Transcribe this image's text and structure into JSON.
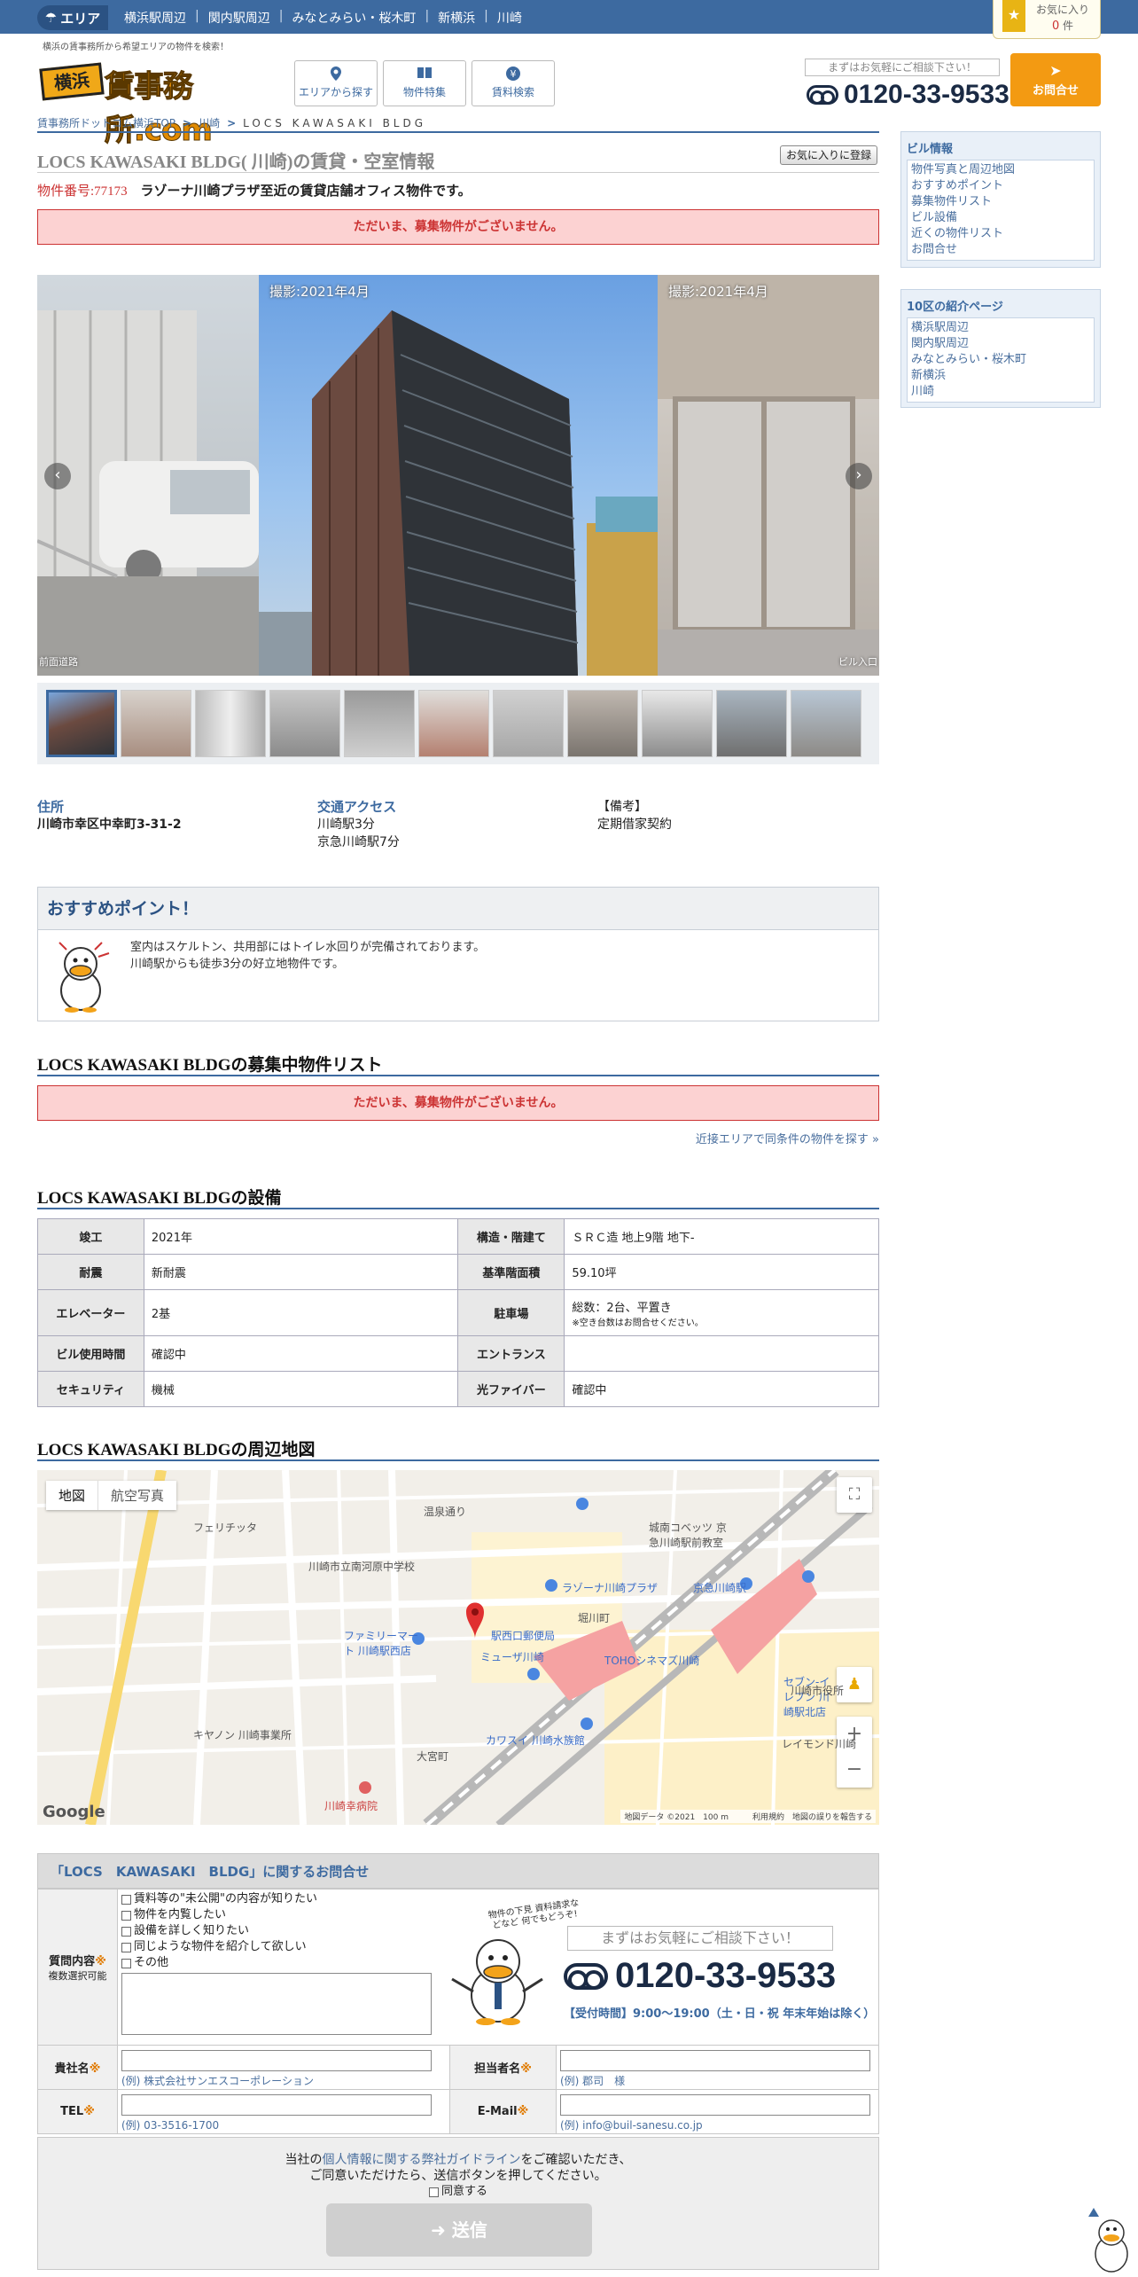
{
  "topbar": {
    "area_label": "エリア",
    "links": [
      "横浜駅周辺",
      "関内駅周辺",
      "みなとみらい・桜木町",
      "新横浜",
      "川崎"
    ],
    "favorites": {
      "label": "お気に入り",
      "count": "0",
      "unit": "件"
    }
  },
  "header": {
    "tagline": "横浜の賃事務所から希望エリアの物件を検索！",
    "logo_badge": "横浜",
    "logo_name": "賃事務所.com",
    "nav": [
      {
        "label": "エリアから探す",
        "icon": "pin-icon"
      },
      {
        "label": "物件特集",
        "icon": "book-icon"
      },
      {
        "label": "賃料検索",
        "icon": "yen-icon"
      }
    ],
    "consult_text": "まずはお気軽にご相談下さい！",
    "phone": "0120-33-9533",
    "contact_label": "お問合せ"
  },
  "breadcrumb": {
    "items": [
      "賃事務所ドットコム横浜TOP",
      "川崎"
    ],
    "current": "LOCS KAWASAKI BLDG"
  },
  "property": {
    "title": "LOCS KAWASAKI BLDG( 川崎)の賃貸・空室情報",
    "fav_add_label": "お気に入りに登録",
    "number_label": "物件番号:77173",
    "description": "ラゾーナ川崎プラザ至近の賃貸店舗オフィス物件です。",
    "no_vacancy": "ただいま、募集物件がございません。"
  },
  "gallery": {
    "center_caption": "撮影:2021年4月",
    "right_caption": "撮影:2021年4月",
    "left_sub": "前面道路",
    "right_sub": "ビル入口",
    "thumb_count": 11
  },
  "info": {
    "address_label": "住所",
    "address": "川崎市幸区中幸町3-31-2",
    "access_label": "交通アクセス",
    "access": [
      "川崎駅3分",
      "京急川崎駅7分"
    ],
    "remarks_label": "【備考】",
    "remarks": "定期借家契約"
  },
  "recommend": {
    "title": "おすすめポイント！",
    "lines": [
      "室内はスケルトン、共用部にはトイレ水回りが完備されております。",
      "川崎駅からも徒歩3分の好立地物件です。"
    ]
  },
  "listing": {
    "title": "LOCS KAWASAKI BLDGの募集中物件リスト",
    "no_vacancy": "ただいま、募集物件がございません。",
    "near_link": "近接エリアで同条件の物件を探す »"
  },
  "facilities": {
    "title": "LOCS KAWASAKI BLDGの設備",
    "rows": [
      {
        "h1": "竣工",
        "v1": "2021年",
        "h2": "構造・階建て",
        "v2": "ＳＲＣ造 地上9階 地下-"
      },
      {
        "h1": "耐震",
        "v1": "新耐震",
        "h2": "基準階面積",
        "v2": "59.10坪"
      },
      {
        "h1": "エレベーター",
        "v1": "2基",
        "h2": "駐車場",
        "v2": "総数：2台、平置き",
        "note": "※空き台数はお問合せください。"
      },
      {
        "h1": "ビル使用時間",
        "v1": "確認中",
        "h2": "エントランス",
        "v2": ""
      },
      {
        "h1": "セキュリティ",
        "v1": "機械",
        "h2": "光ファイバー",
        "v2": "確認中"
      }
    ]
  },
  "map": {
    "title": "LOCS KAWASAKI BLDGの周辺地図",
    "tab_map": "地図",
    "tab_satellite": "航空写真",
    "labels": [
      {
        "t": "フェリチッタ",
        "c": ""
      },
      {
        "t": "川崎市立南河原中学校",
        "c": ""
      },
      {
        "t": "ラゾーナ川崎プラザ",
        "c": "blue"
      },
      {
        "t": "京急川崎駅",
        "c": "blue"
      },
      {
        "t": "ファミリーマート 川崎駅西店",
        "c": "blue"
      },
      {
        "t": "駅西口郵便局",
        "c": "blue"
      },
      {
        "t": "ミューザ川崎",
        "c": "blue"
      },
      {
        "t": "TOHOシネマズ川崎",
        "c": "blue"
      },
      {
        "t": "キヤノン 川崎事業所",
        "c": ""
      },
      {
        "t": "カワスイ 川崎水族館",
        "c": "blue"
      },
      {
        "t": "川崎幸病院",
        "c": "red"
      },
      {
        "t": "セブン-イレブン 川崎駅北店",
        "c": "blue"
      },
      {
        "t": "レイモンド川崎",
        "c": ""
      },
      {
        "t": "川崎市役所",
        "c": ""
      },
      {
        "t": "城南コベッツ 京急川崎駅前教室",
        "c": ""
      },
      {
        "t": "温泉通り",
        "c": ""
      },
      {
        "t": "堀川町",
        "c": ""
      },
      {
        "t": "大宮町",
        "c": ""
      }
    ],
    "footer": "地図データ ©2021　100 m　　　利用規約　地図の誤りを報告する",
    "google": "Google"
  },
  "inquiry": {
    "title": "「LOCS　KAWASAKI　BLDG」に関するお問合せ",
    "question_label": "質問内容",
    "question_sub": "複数選択可能",
    "options": [
      "賃料等の\"未公開\"の内容が知りたい",
      "物件を内覧したい",
      "設備を詳しく知りたい",
      "同じような物件を紹介して欲しい",
      "その他"
    ],
    "company_label": "貴社名",
    "company_hint": "(例) 株式会社サンエスコーポレーション",
    "person_label": "担当者名",
    "person_hint": "(例) 郡司　様",
    "tel_label": "TEL",
    "tel_hint": "(例) 03-3516-1700",
    "email_label": "E-Mail",
    "email_hint": "(例) info@buil-sanesu.co.jp",
    "bubble": "物件の下見 資料請求などなど 何でもどうぞ!",
    "consult_text": "まずはお気軽にご相談下さい！",
    "phone": "0120-33-9533",
    "hours": "【受付時間】9:00～19:00（土・日・祝 年末年始は除く）",
    "privacy_pre": "当社の",
    "privacy_link": "個人情報に関する弊社ガイドライン",
    "privacy_post": "をご確認いただき、",
    "privacy_line2": "ご同意いただけたら、送信ボタンを押してください。",
    "agree": "同意する",
    "submit": "送信"
  },
  "sidebar": {
    "building_info_title": "ビル情報",
    "building_info": [
      "物件写真と周辺地図",
      "おすすめポイント",
      "募集物件リスト",
      "ビル設備",
      "近くの物件リスト",
      "お問合せ"
    ],
    "areas_title": "10区の紹介ページ",
    "areas": [
      "横浜駅周辺",
      "関内駅周辺",
      "みなとみらい・桜木町",
      "新横浜",
      "川崎"
    ]
  }
}
